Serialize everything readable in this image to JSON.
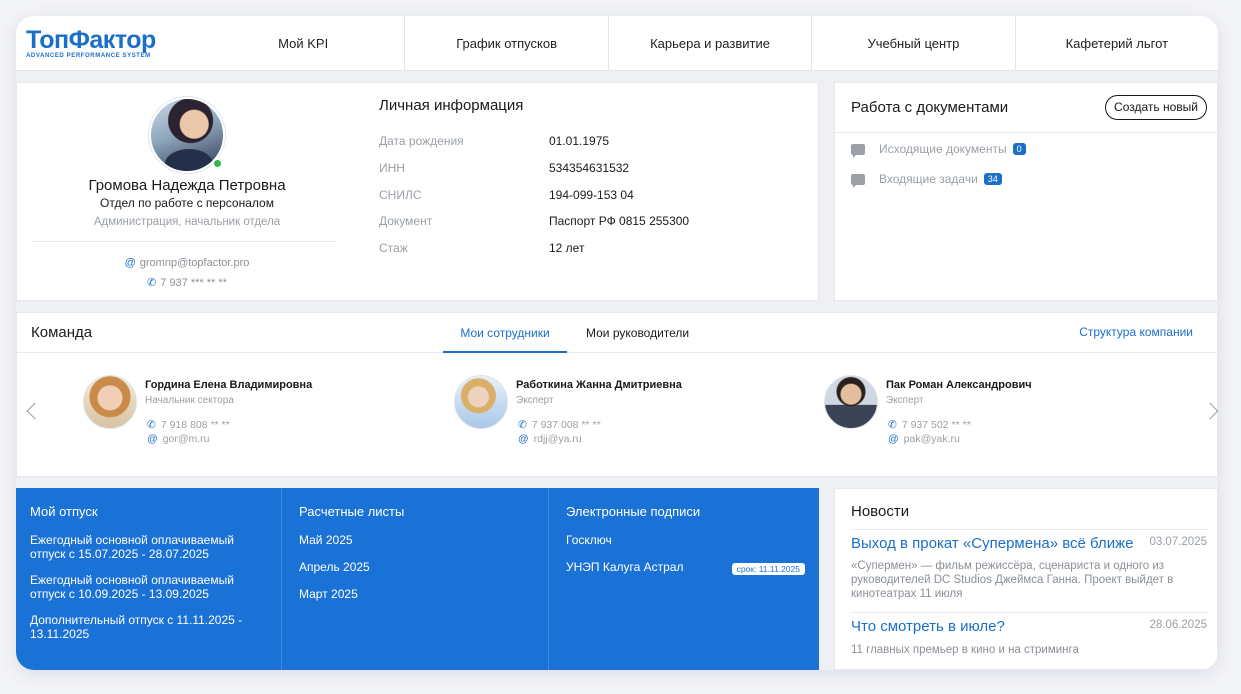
{
  "logo": {
    "main": "ТопФактор",
    "sub": "ADVANCED PERFORMANCE SYSTEM"
  },
  "nav": [
    "Мой KPI",
    "График отпусков",
    "Карьера и развитие",
    "Учебный центр",
    "Кафетерий льгот"
  ],
  "profile": {
    "name": "Громова Надежда Петровна",
    "department": "Отдел по работе с персоналом",
    "role": "Администрация, начальник отдела",
    "email": "gromnp@topfactor.pro",
    "phone": "7 937 *** ** **",
    "status_color": "#2db84d"
  },
  "personal_info": {
    "title": "Личная информация",
    "rows": [
      {
        "label": "Дата рождения",
        "value": "01.01.1975"
      },
      {
        "label": "ИНН",
        "value": "534354631532"
      },
      {
        "label": "СНИЛС",
        "value": "194-099-153 04"
      },
      {
        "label": "Документ",
        "value": "Паспорт РФ 0815 255300"
      },
      {
        "label": "Стаж",
        "value": "12 лет"
      }
    ]
  },
  "documents": {
    "title": "Работа с документами",
    "create_label": "Создать новый",
    "items": [
      {
        "label": "Исходящие документы",
        "count": "0"
      },
      {
        "label": "Входящие задачи",
        "count": "34"
      }
    ]
  },
  "team": {
    "title": "Команда",
    "tabs": [
      "Мои сотрудники",
      "Мои руководители"
    ],
    "active_tab": "Мои сотрудники",
    "structure_link": "Структура компании",
    "members": [
      {
        "name": "Гордина Елена Владимировна",
        "role": "Начальник сектора",
        "phone": "7 918 808 ** **",
        "email": "gor@m.ru"
      },
      {
        "name": "Работкина Жанна Дмитриевна",
        "role": "Эксперт",
        "phone": "7 937 008 ** **",
        "email": "rdjj@ya.ru"
      },
      {
        "name": "Пак Роман Александрович",
        "role": "Эксперт",
        "phone": "7 937 502 ** **",
        "email": "pak@yak.ru"
      }
    ]
  },
  "vacation": {
    "title": "Мой отпуск",
    "items": [
      "Ежегодный основной оплачиваемый отпуск с 15.07.2025 - 28.07.2025",
      "Ежегодный основной оплачиваемый отпуск с 10.09.2025 - 13.09.2025",
      "Дополнительный отпуск с 11.11.2025 - 13.11.2025"
    ]
  },
  "payslips": {
    "title": "Расчетные листы",
    "items": [
      "Май 2025",
      "Апрель 2025",
      "Март 2025"
    ]
  },
  "signatures": {
    "title": "Электронные подписи",
    "items": [
      "Госключ",
      "УНЭП Калуга Астрал"
    ],
    "deadline": "срок: 11.11.2025"
  },
  "news": {
    "title": "Новости",
    "items": [
      {
        "headline": "Выход в прокат «Супермена» всё ближе",
        "date": "03.07.2025",
        "text": "«Супермен» — фильм режиссёра, сценариста и одного из руководителей DC Studios Джеймса Ганна. Проект выйдет в кинотеатрах 11 июля"
      },
      {
        "headline": "Что смотреть в июле?",
        "date": "28.06.2025",
        "text": "11 главных премьер в кино и на стриминга"
      }
    ]
  },
  "colors": {
    "accent": "#1b6fc8",
    "panel_blue": "#1b72d6"
  }
}
